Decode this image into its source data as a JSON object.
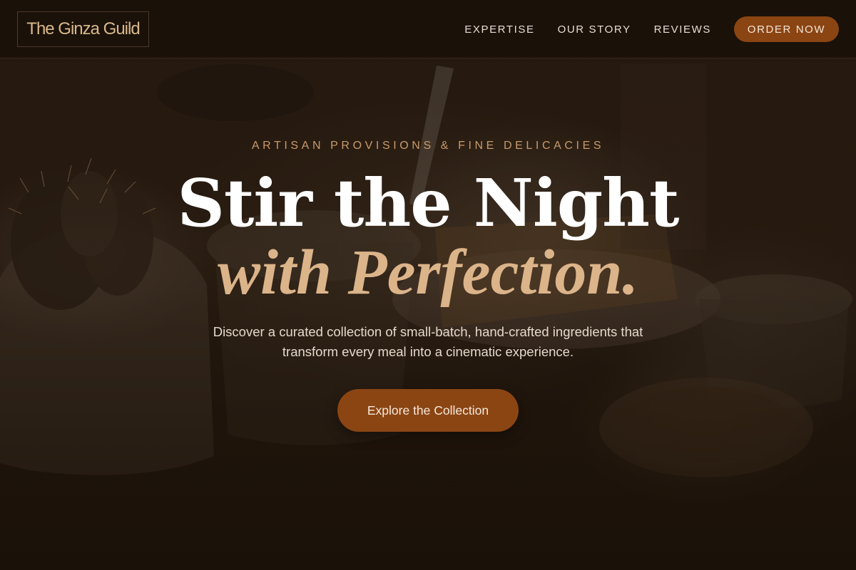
{
  "header": {
    "logo_text": "The Ginza Guild",
    "nav": [
      {
        "label": "EXPERTISE"
      },
      {
        "label": "OUR STORY"
      },
      {
        "label": "REVIEWS"
      }
    ],
    "cta_label": "ORDER NOW"
  },
  "hero": {
    "eyebrow": "ARTISAN PROVISIONS & FINE DELICACIES",
    "title_line1": "Stir the Night",
    "title_line2": "with Perfection.",
    "subtitle": "Discover a curated collection of small-batch, hand-crafted ingredients that transform every meal into a cinematic experience.",
    "cta_label": "Explore the Collection"
  },
  "colors": {
    "accent": "#8b4513",
    "gold": "#dcb48a",
    "eyebrow": "#c89a6b",
    "header_bg": "#1a1109"
  },
  "background_image": "blurred coffee table photo with cactus plant, cups and cake"
}
